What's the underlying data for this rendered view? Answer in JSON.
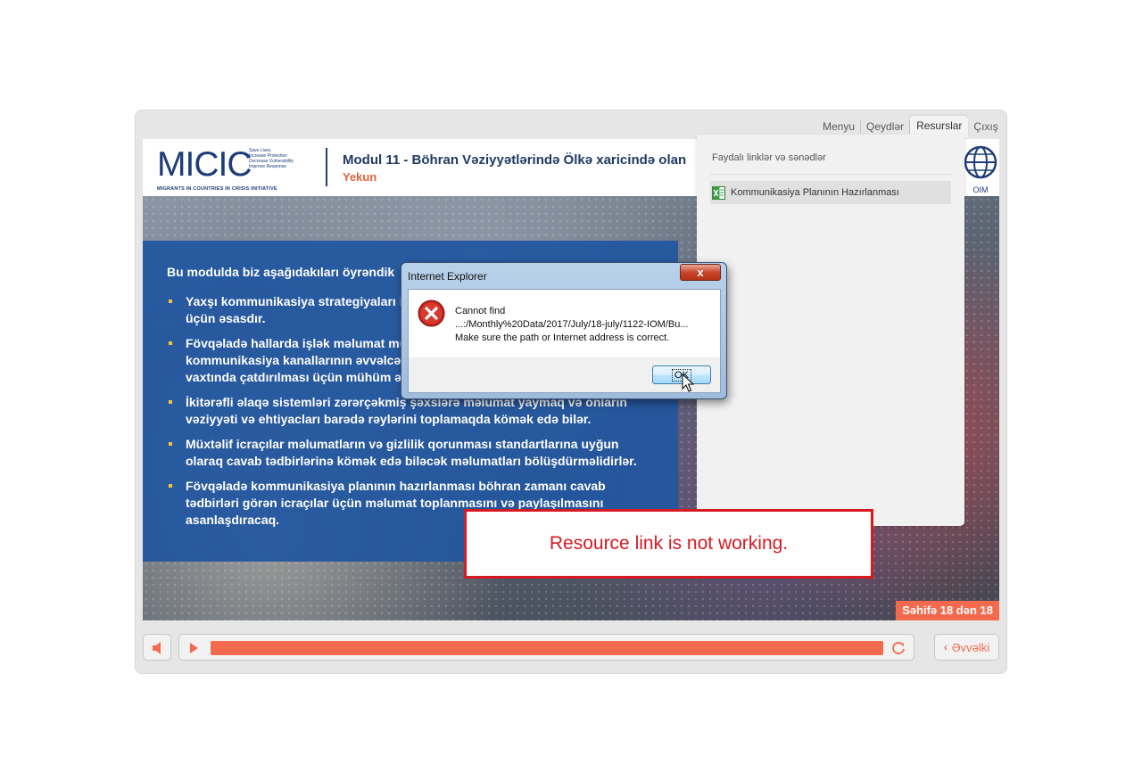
{
  "nav": {
    "tabs": [
      {
        "label": "Menyu"
      },
      {
        "label": "Qeydlər"
      },
      {
        "label": "Resurslar",
        "active": true
      },
      {
        "label": "Çıxış"
      }
    ]
  },
  "header": {
    "logo_text": "MICIC",
    "logo_tagline": [
      "Save Lives",
      "Increase Protection",
      "Decrease Vulnerability",
      "Improve Response"
    ],
    "logo_subtitle": "MIGRANTS IN COUNTRIES IN CRISIS INITIATIVE",
    "module_title": "Modul 11 - Böhran Vəziyyətlərində Ölkə xaricində olan",
    "module_subtitle": "Yekun",
    "partner_logo_text": "OIM"
  },
  "slide": {
    "intro": "Bu modulda biz aşağıdakıları öyrəndik",
    "bullets": [
      "Yaxşı kommunikasiya strategiyaları böhran zamanı effektiv cavab tədbirləri üçün əsasdır.",
      "Fövqəladə hallarda işlək məlumat mübadiləsi sistemlərinin və kommunikasiya kanallarının əvvəlcədən müəyyənləşdirilməsi məlumatın vaxtında çatdırılması üçün mühüm əhəmiyyət kəsb edir.",
      "İkitərəfli əlaqə sistemləri zərərçəkmiş şəxslərə məlumat yaymaq və onların vəziyyəti və ehtiyacları barədə rəylərini toplamaqda kömək edə bilər.",
      "Müxtəlif icraçılar məlumatların və gizlilik qorunması standartlarına uyğun olaraq cavab tədbirlərinə kömək edə biləcək məlumatları bölüşdürməlidirlər.",
      "Fövqəladə kommunikasiya planının hazırlanması böhran zamanı cavab tədbirləri görən icraçılar üçün məlumat toplanmasını və paylaşılmasını asanlaşdıracaq."
    ],
    "page_counter": "Səhifə 18 dən 18"
  },
  "resources": {
    "heading": "Faydalı linklər və sənədlər",
    "items": [
      {
        "label": "Kommunikasiya Planının Hazırlanması",
        "icon": "excel-icon"
      }
    ]
  },
  "controls": {
    "prev_label": "Əvvəlki",
    "progress": 1.0
  },
  "annotation": {
    "text": "Resource link is not working."
  },
  "dialog": {
    "title": "Internet Explorer",
    "close_label": "x",
    "message_lines": [
      "Cannot find",
      "...:/Monthly%20Data/2017/July/18-july/1122-IOM/Bu...",
      "Make sure the path or Internet address is correct."
    ],
    "ok_label": "OK"
  },
  "colors": {
    "accent": "#f26b4f",
    "panel_blue": "#2156a0",
    "annotation_red": "#d71921"
  }
}
